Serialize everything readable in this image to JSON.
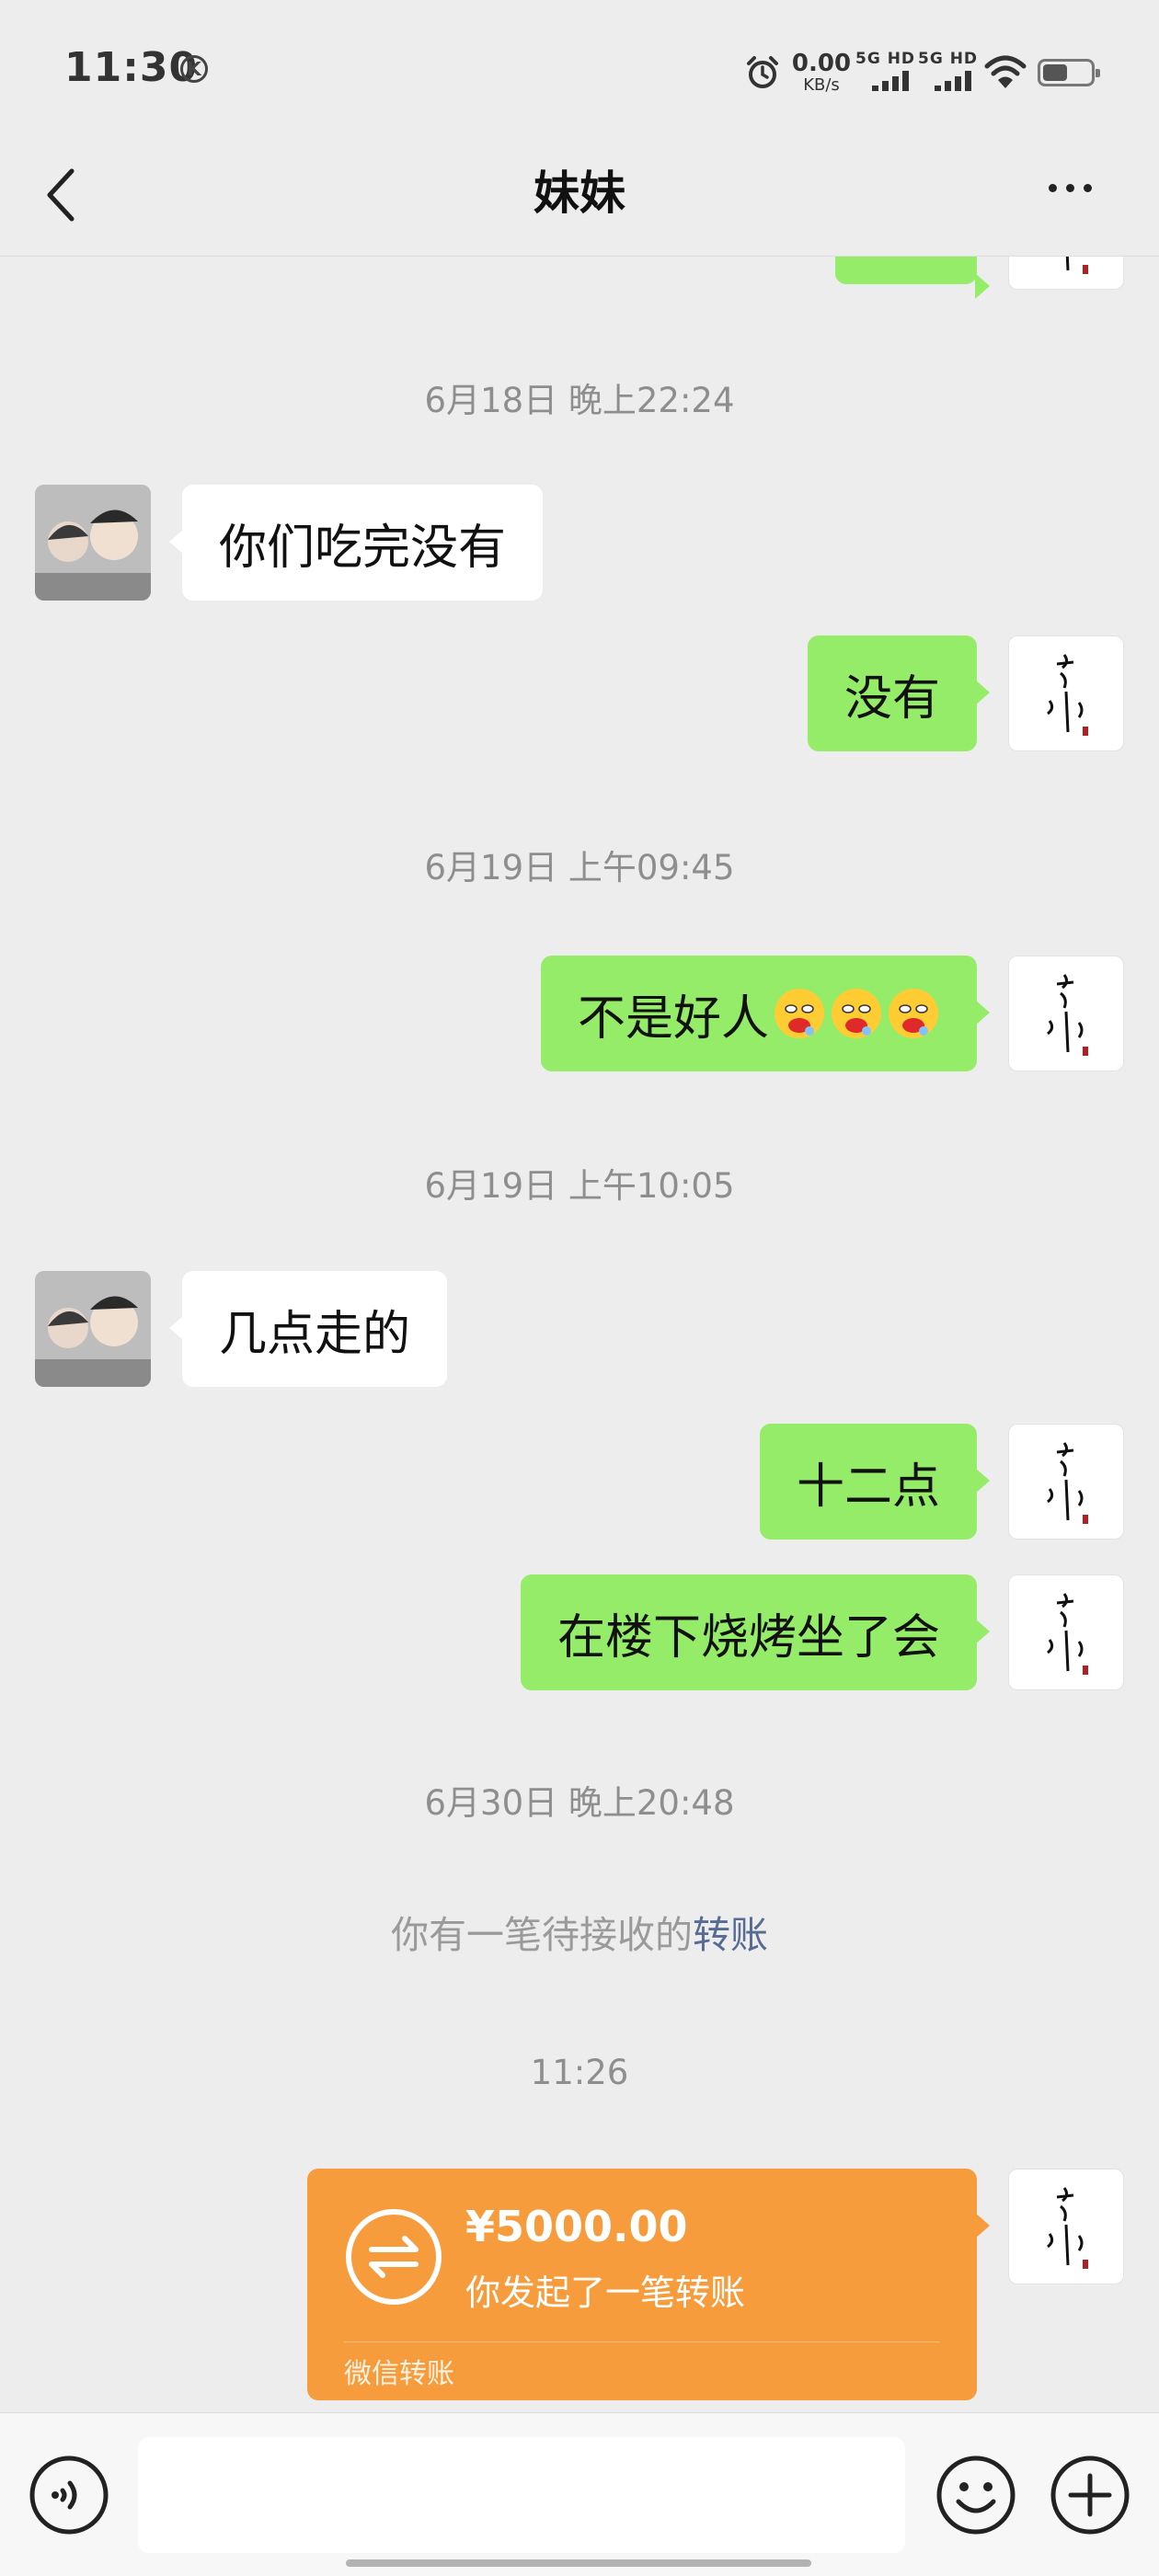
{
  "status_bar": {
    "time": "11:30",
    "k_badge": "K",
    "net_speed_value": "0.00",
    "net_speed_unit": "KB/s",
    "sim1_label": "5G HD",
    "sim2_label": "5G HD",
    "icons": [
      "alarm-icon",
      "wifi-icon",
      "battery-icon"
    ]
  },
  "nav": {
    "title": "妹妹",
    "icons": [
      "back-chevron-icon",
      "more-dots-icon"
    ]
  },
  "messages": [
    {
      "type": "timestamp",
      "text": "6月18日 晚上22:24"
    },
    {
      "type": "received",
      "text": "你们吃完没有"
    },
    {
      "type": "sent",
      "text": "没有"
    },
    {
      "type": "timestamp",
      "text": "6月19日 上午09:45"
    },
    {
      "type": "sent",
      "text": "不是好人",
      "emoji_count": 3
    },
    {
      "type": "timestamp",
      "text": "6月19日 上午10:05"
    },
    {
      "type": "received",
      "text": "几点走的"
    },
    {
      "type": "sent",
      "text": "十二点"
    },
    {
      "type": "sent",
      "text": "在楼下烧烤坐了会"
    },
    {
      "type": "timestamp",
      "text": "6月30日 晚上20:48"
    },
    {
      "type": "system",
      "text": "你有一笔待接收的",
      "link": "转账"
    },
    {
      "type": "timestamp",
      "text": "11:26"
    }
  ],
  "transfer": {
    "amount": "¥5000.00",
    "description": "你发起了一笔转账",
    "footer": "微信转账"
  },
  "input_bar": {
    "value": "",
    "icons": [
      "voice-icon",
      "emoji-icon",
      "plus-icon"
    ]
  },
  "colors": {
    "sent_bubble": "#95ec69",
    "received_bubble": "#ffffff",
    "background": "#ededed",
    "transfer_card": "#f79c3c",
    "link": "#576b95"
  }
}
